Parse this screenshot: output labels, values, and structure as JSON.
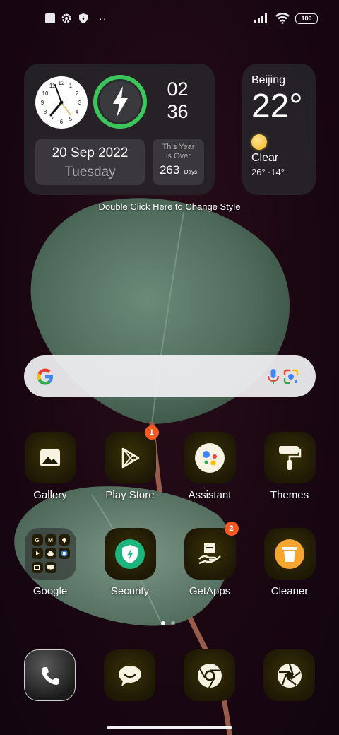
{
  "status_bar": {
    "battery": "100",
    "icons": [
      "square-icon",
      "gear-icon",
      "shield-icon",
      "more-dots-icon",
      "signal-icon",
      "wifi-icon",
      "battery-icon"
    ],
    "dots": "··"
  },
  "clock_widget": {
    "hour": "02",
    "minute": "36",
    "date": "20 Sep 2022",
    "weekday": "Tuesday",
    "year_label_line1": "This Year",
    "year_label_line2": "is Over",
    "days_count": "263",
    "days_unit": "Days",
    "ring_color": "#3bc55b"
  },
  "weather": {
    "city": "Beijing",
    "temp": "22°",
    "condition": "Clear",
    "range": "26°~14°"
  },
  "hint": "Double Click Here to Change Style",
  "apps": [
    {
      "label": "Gallery",
      "icon": "gallery-icon",
      "badge": ""
    },
    {
      "label": "Play Store",
      "icon": "play-store-icon",
      "badge": "1"
    },
    {
      "label": "Assistant",
      "icon": "assistant-icon",
      "badge": ""
    },
    {
      "label": "Themes",
      "icon": "paint-roller-icon",
      "badge": ""
    },
    {
      "label": "Google",
      "icon": "folder-icon",
      "badge": ""
    },
    {
      "label": "Security",
      "icon": "shield-bolt-icon",
      "badge": ""
    },
    {
      "label": "GetApps",
      "icon": "getapps-icon",
      "badge": "2"
    },
    {
      "label": "Cleaner",
      "icon": "trash-icon",
      "badge": ""
    }
  ],
  "folder_mini_icons": [
    "G",
    "M",
    "",
    "",
    "",
    "",
    "",
    ""
  ],
  "dock": [
    "phone-icon",
    "messages-icon",
    "chrome-icon",
    "camera-icon"
  ],
  "colors": {
    "accent_green": "#3bc55b",
    "badge_orange": "#f35a1f",
    "icon_bg": "#231d06",
    "glyph_cream": "#f7f3e2"
  }
}
